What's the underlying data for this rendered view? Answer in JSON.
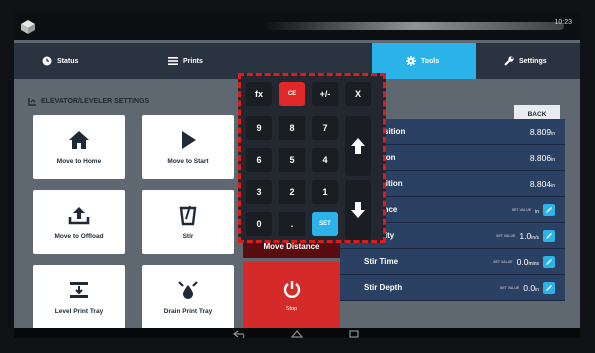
{
  "status_bar": {
    "time": "10:23",
    "logo_icon": "cube-logo-icon"
  },
  "tabs": [
    {
      "label": "Status",
      "icon": "clock-icon"
    },
    {
      "label": "Prints",
      "icon": "list-icon"
    },
    {
      "label": "Tools",
      "icon": "gear-icon"
    },
    {
      "label": "Settings",
      "icon": "wrench-icon"
    }
  ],
  "section": {
    "title": "ELEVATOR/LEVELER SETTINGS",
    "back_label": "BACK"
  },
  "tiles": [
    {
      "label": "Move to Home",
      "icon": "home-icon"
    },
    {
      "label": "Move to Start",
      "icon": "play-icon"
    },
    {
      "label": "Move to Offload",
      "icon": "upload-icon"
    },
    {
      "label": "Stir",
      "icon": "stir-icon"
    },
    {
      "label": "Level Print Tray",
      "icon": "level-icon"
    },
    {
      "label": "Drain Print Tray",
      "icon": "drain-icon"
    }
  ],
  "rows": [
    {
      "label": "nt Position",
      "value": "8.809",
      "unit": "in"
    },
    {
      "label": "Position",
      "value": "8.806",
      "unit": "in"
    },
    {
      "label": "d Position",
      "value": "8.804",
      "unit": "in"
    },
    {
      "label": "Distance",
      "value": "",
      "unit": "in",
      "set_label": "SET VALUE"
    },
    {
      "label": "Velocity",
      "value": "1.0",
      "unit": "in/s",
      "set_label": "SET VALUE"
    },
    {
      "label": "Stir Time",
      "value": "0.0",
      "unit": "mins",
      "set_label": "SET VALUE"
    },
    {
      "label": "Stir Depth",
      "value": "0.0",
      "unit": "in",
      "set_label": "SET VALUE"
    }
  ],
  "move_distance_label": "Move Distance",
  "stop_label": "Stop",
  "keypad": {
    "top": [
      "fx",
      "CE",
      "+/-",
      "X"
    ],
    "digits": [
      "9",
      "8",
      "7",
      "6",
      "5",
      "4",
      "3",
      "2",
      "1",
      "0",
      "."
    ],
    "set": "SET"
  },
  "colors": {
    "accent": "#2bb3ea",
    "stop": "#d52a2a",
    "row_bg": "#2a4163",
    "highlight": "#e01919"
  }
}
